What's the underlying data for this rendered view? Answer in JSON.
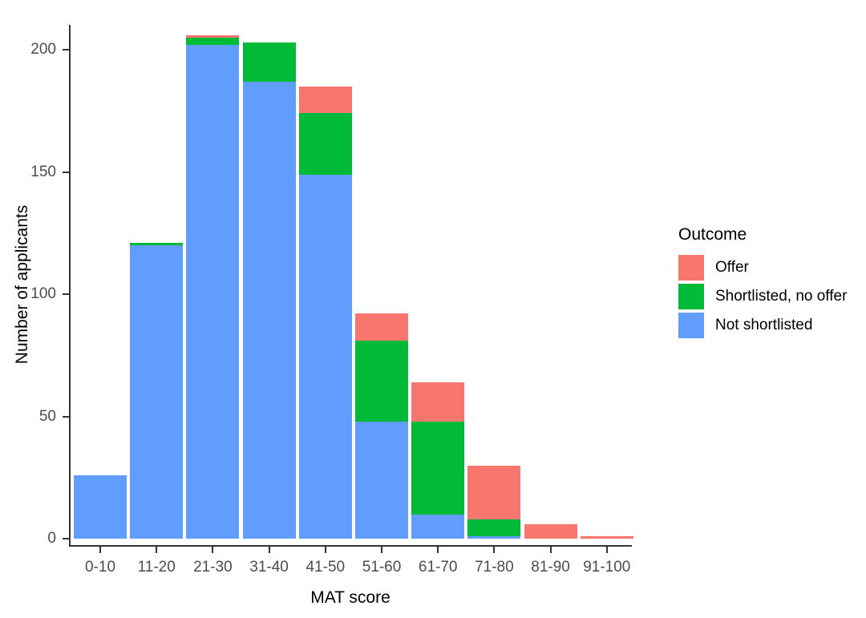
{
  "chart_data": {
    "type": "bar",
    "subtype": "stacked",
    "title": "",
    "xlabel": "MAT score",
    "ylabel": "Number of applicants",
    "categories": [
      "0-10",
      "11-20",
      "21-30",
      "31-40",
      "41-50",
      "51-60",
      "61-70",
      "71-80",
      "81-90",
      "91-100"
    ],
    "series": [
      {
        "name": "Not shortlisted",
        "color": "#619CFF",
        "values": [
          26,
          120,
          202,
          187,
          149,
          48,
          10,
          1,
          0,
          0
        ]
      },
      {
        "name": "Shortlisted, no offer",
        "color": "#00BA38",
        "values": [
          0,
          1,
          3,
          16,
          25,
          33,
          38,
          7,
          0,
          0
        ]
      },
      {
        "name": "Offer",
        "color": "#F8766D",
        "values": [
          0,
          0,
          1,
          0,
          11,
          11,
          16,
          22,
          6,
          1
        ]
      }
    ],
    "stack_order_bottom_to_top": [
      "Not shortlisted",
      "Shortlisted, no offer",
      "Offer"
    ],
    "stack_totals": [
      26,
      121,
      206,
      203,
      185,
      92,
      64,
      30,
      6,
      1
    ],
    "ylim": [
      0,
      215
    ],
    "y_ticks": [
      0,
      50,
      100,
      150,
      200
    ],
    "y_tick_labels": [
      "0",
      "50",
      "100",
      "150",
      "200"
    ],
    "x_tick_labels": [
      "0-10",
      "11-20",
      "21-30",
      "31-40",
      "41-50",
      "51-60",
      "61-70",
      "71-80",
      "81-90",
      "91-100"
    ],
    "grid": false,
    "legend_position": "right",
    "background": "#FFFFFF"
  },
  "legend": {
    "title": "Outcome",
    "items": [
      {
        "label": "Offer",
        "color": "#F8766D",
        "swatch_name": "legend-swatch-offer"
      },
      {
        "label": "Shortlisted, no offer",
        "color": "#00BA38",
        "swatch_name": "legend-swatch-shortlisted-no-offer"
      },
      {
        "label": "Not shortlisted",
        "color": "#619CFF",
        "swatch_name": "legend-swatch-not-shortlisted"
      }
    ]
  },
  "axes": {
    "y_title": "Number of applicants",
    "x_title": "MAT score"
  },
  "colors": {
    "offer": "#F8766D",
    "shortlisted_no_offer": "#00BA38",
    "not_shortlisted": "#619CFF",
    "axis": "#333333",
    "tick_label": "#4D4D4D",
    "text": "#000000"
  }
}
